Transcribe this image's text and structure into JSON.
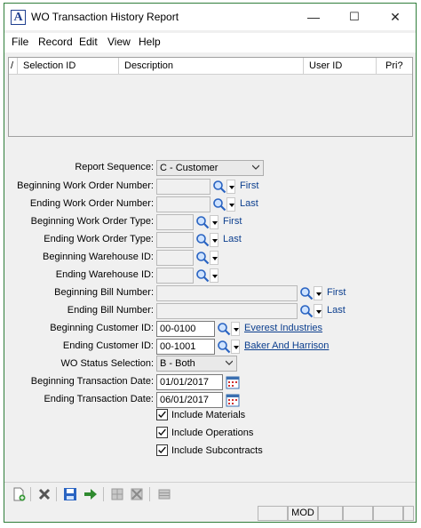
{
  "window": {
    "title": "WO Transaction History Report",
    "app_icon_letter": "A",
    "controls": {
      "minimize": "—",
      "maximize": "☐",
      "close": "✕"
    }
  },
  "menu": [
    "File",
    "Record",
    "Edit",
    "View",
    "Help"
  ],
  "grid": {
    "marker": "/",
    "columns": [
      "Selection ID",
      "Description",
      "User ID",
      "Pri?"
    ]
  },
  "form": {
    "report_sequence": {
      "label": "Report Sequence:",
      "value": "C - Customer"
    },
    "beg_wo_number": {
      "label": "Beginning Work Order Number:",
      "value": "",
      "side": "First"
    },
    "end_wo_number": {
      "label": "Ending Work Order Number:",
      "value": "",
      "side": "Last"
    },
    "beg_wo_type": {
      "label": "Beginning Work Order Type:",
      "value": "",
      "side": "First"
    },
    "end_wo_type": {
      "label": "Ending Work Order Type:",
      "value": "",
      "side": "Last"
    },
    "beg_warehouse": {
      "label": "Beginning Warehouse ID:",
      "value": ""
    },
    "end_warehouse": {
      "label": "Ending Warehouse ID:",
      "value": ""
    },
    "beg_bill": {
      "label": "Beginning Bill Number:",
      "value": "",
      "side": "First"
    },
    "end_bill": {
      "label": "Ending Bill Number:",
      "value": "",
      "side": "Last"
    },
    "beg_customer": {
      "label": "Beginning Customer ID:",
      "value": "00-0100",
      "side": "Everest Industries"
    },
    "end_customer": {
      "label": "Ending Customer ID:",
      "value": "00-1001",
      "side": "Baker And Harrison"
    },
    "wo_status": {
      "label": "WO Status Selection:",
      "value": "B - Both"
    },
    "beg_date": {
      "label": "Beginning Transaction Date:",
      "value": "01/01/2017"
    },
    "end_date": {
      "label": "Ending Transaction Date:",
      "value": "06/01/2017"
    },
    "include_materials": {
      "label": "Include Materials",
      "checked": true
    },
    "include_operations": {
      "label": "Include Operations",
      "checked": true
    },
    "include_subcontracts": {
      "label": "Include Subcontracts",
      "checked": true
    }
  },
  "status_bar": {
    "mode": "MOD"
  },
  "colors": {
    "link": "#0b3e8e",
    "accent_green": "#2f8a2f",
    "title_icon": "#1f3f8f"
  }
}
